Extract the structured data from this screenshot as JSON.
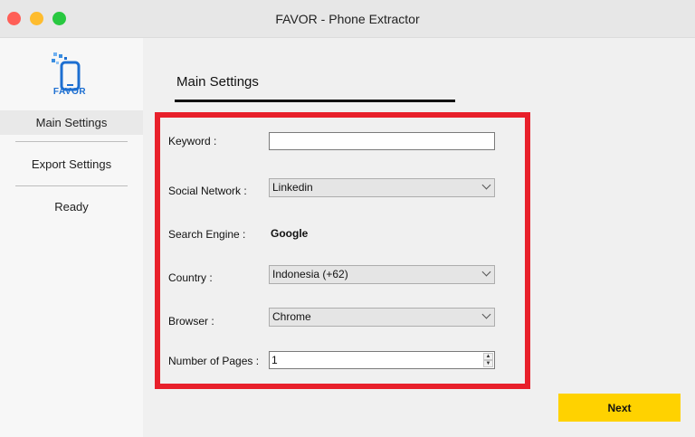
{
  "window": {
    "title": "FAVOR - Phone Extractor"
  },
  "sidebar": {
    "logo_text": "FAVOR",
    "logo_icon": "phone-icon",
    "items": [
      {
        "label": "Main Settings",
        "selected": true
      },
      {
        "label": "Export Settings",
        "selected": false
      },
      {
        "label": "Ready",
        "selected": false
      }
    ]
  },
  "main": {
    "title": "Main Settings",
    "fields": {
      "keyword": {
        "label": "Keyword :",
        "value": ""
      },
      "social_network": {
        "label": "Social Network :",
        "value": "Linkedin"
      },
      "search_engine": {
        "label": "Search Engine :",
        "value": "Google"
      },
      "country": {
        "label": "Country :",
        "value": "Indonesia (+62)"
      },
      "browser": {
        "label": "Browser :",
        "value": "Chrome"
      },
      "pages": {
        "label": "Number of Pages :",
        "value": "1"
      }
    },
    "next_label": "Next"
  },
  "colors": {
    "highlight_border": "#e8202b",
    "next_button": "#ffd200",
    "logo_blue": "#1d6fd1"
  }
}
